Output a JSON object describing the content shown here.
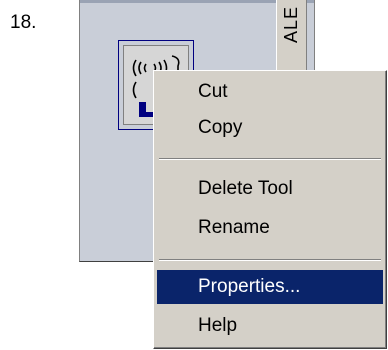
{
  "step": {
    "number": "18."
  },
  "palette": {
    "side_tab_label": "ALE",
    "tool_icon": "wireless-antenna-tool-icon"
  },
  "context_menu": {
    "items": [
      {
        "label": "Cut"
      },
      {
        "label": "Copy"
      },
      {
        "label": "Delete Tool"
      },
      {
        "label": "Rename"
      },
      {
        "label": "Properties...",
        "highlighted": true
      },
      {
        "label": "Help"
      }
    ]
  },
  "colors": {
    "menu_face": "#d4d0c8",
    "highlight": "#0a246a",
    "highlight_text": "#ffffff",
    "palette_bg": "#c9ced8"
  }
}
